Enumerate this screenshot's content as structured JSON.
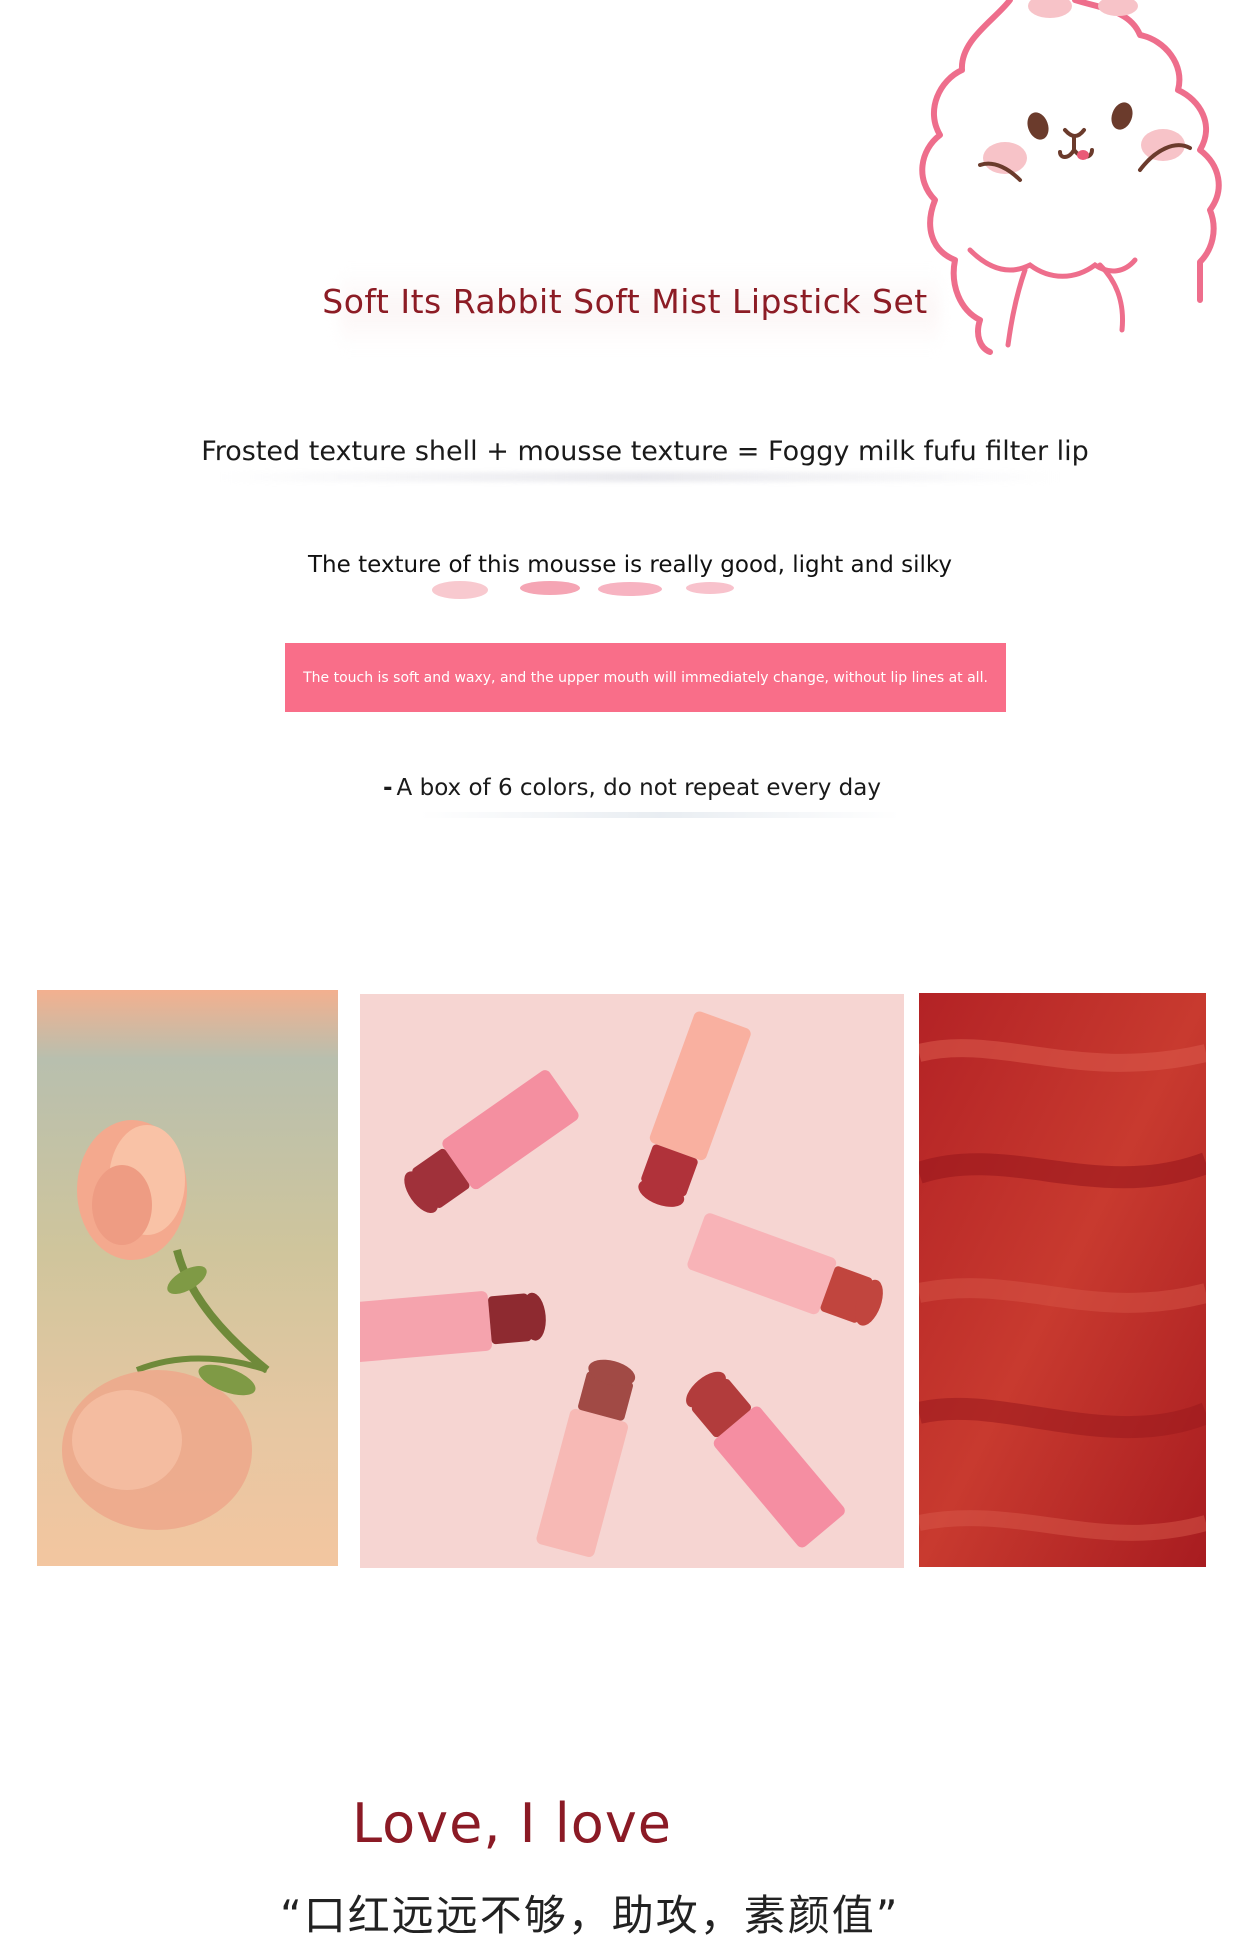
{
  "header": {
    "title": "Soft Its Rabbit Soft Mist Lipstick Set"
  },
  "features": {
    "texture_formula": "Frosted texture shell + mousse texture = Foggy milk fufu filter lip",
    "texture_note": "The texture of this mousse is really good, light and silky",
    "banner_text": "The touch is soft and waxy, and the upper mouth will immediately change, without lip lines at all.",
    "colors_bullet": "-",
    "colors_note": "A box of 6 colors, do not repeat every day"
  },
  "gallery": {
    "images": [
      {
        "name": "rose-photo-icon"
      },
      {
        "name": "lipsticks-photo-icon"
      },
      {
        "name": "red-swatch-photo-icon"
      }
    ]
  },
  "footer": {
    "headline": "Love, I love",
    "quote": "“口红远远不够，助攻，素颜值”"
  },
  "colors": {
    "title": "#8c1c25",
    "banner": "#f96e89",
    "mascot_outline": "#ee6e8c",
    "mascot_blush": "#f7c3c8"
  }
}
